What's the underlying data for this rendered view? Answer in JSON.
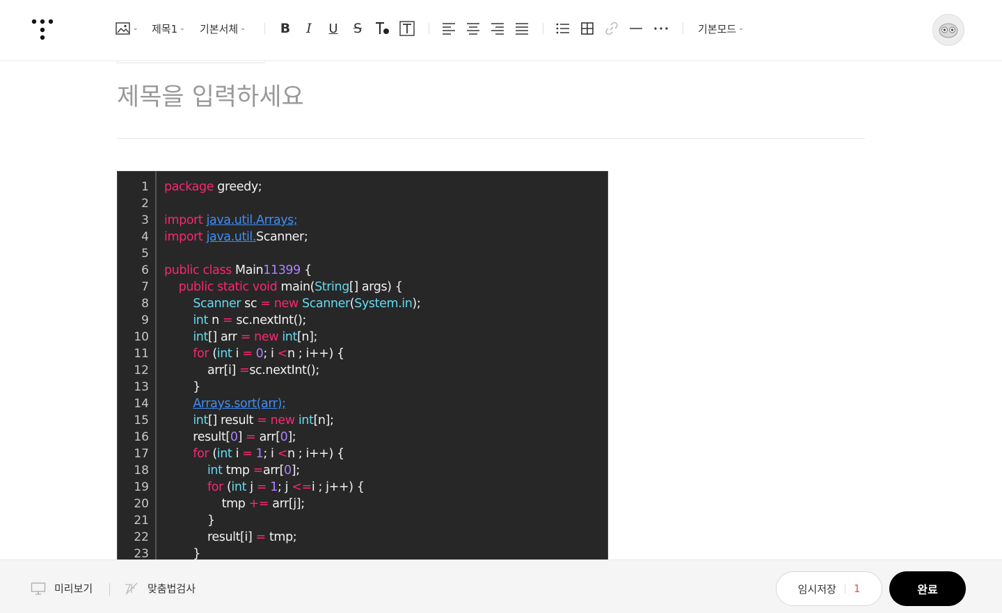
{
  "toolbar": {
    "text_style_label": "제목1",
    "font_label": "기본서체",
    "mode_label": "기본모드"
  },
  "editor": {
    "title_placeholder": "제목을 입력하세요",
    "line_numbers": [
      "1",
      "2",
      "3",
      "4",
      "5",
      "6",
      "7",
      "8",
      "9",
      "10",
      "11",
      "12",
      "13",
      "14",
      "15",
      "16",
      "17",
      "18",
      "19",
      "20",
      "21",
      "22",
      "23"
    ],
    "code_lines": [
      "package greedy;",
      "",
      "import java.util.Arrays;",
      "import java.util.Scanner;",
      "",
      "public class Main11399 {",
      "    public static void main(String[] args) {",
      "        Scanner sc = new Scanner(System.in);",
      "        int n = sc.nextInt();",
      "        int[] arr = new int[n];",
      "        for (int i = 0; i <n ; i++) {",
      "            arr[i] =sc.nextInt();",
      "        }",
      "        Arrays.sort(arr);",
      "        int[] result = new int[n];",
      "        result[0] = arr[0];",
      "        for (int i = 1; i <n ; i++) {",
      "            int tmp =arr[0];",
      "            for (int j = 1; j <=i ; j++) {",
      "                tmp += arr[j];",
      "            }",
      "            result[i] = tmp;",
      "        }"
    ]
  },
  "bottom": {
    "preview_label": "미리보기",
    "spellcheck_label": "맞춤법검사",
    "draft_label": "임시저장",
    "draft_count": "1",
    "done_label": "완료"
  }
}
